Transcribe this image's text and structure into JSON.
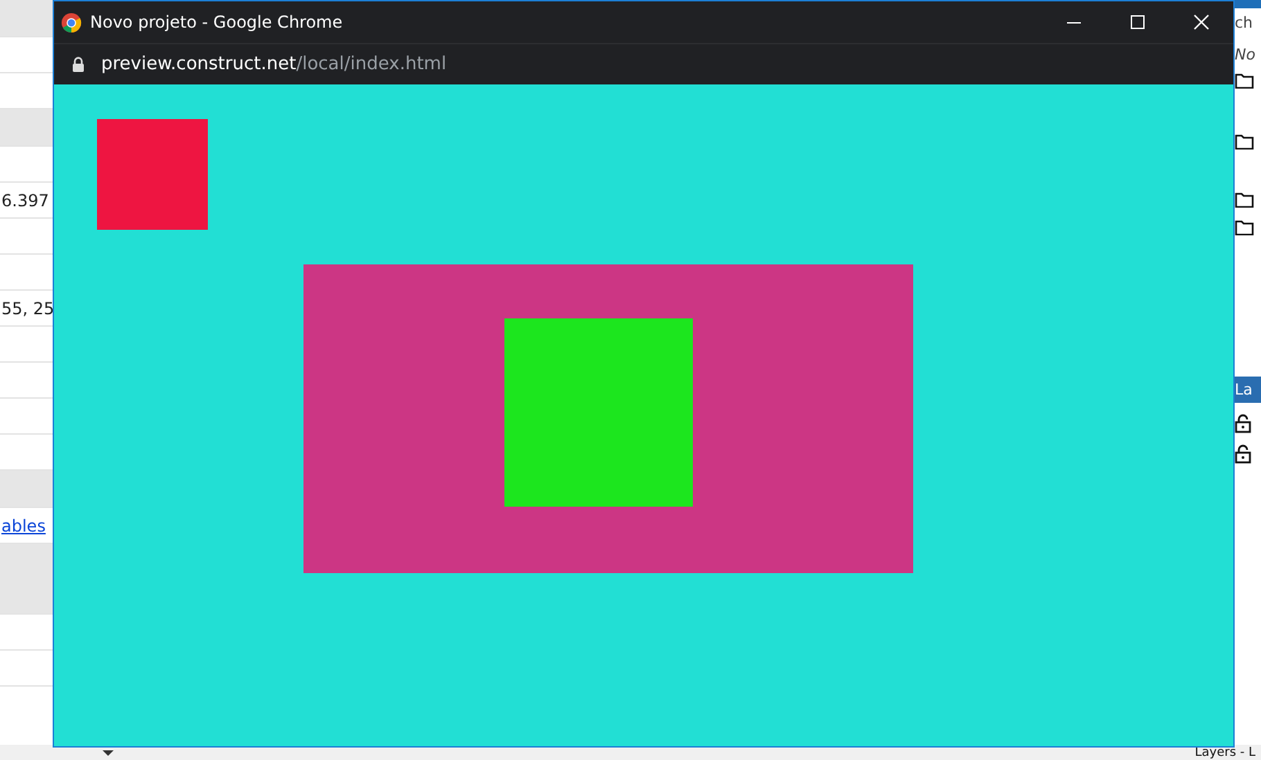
{
  "window": {
    "title": "Novo projeto - Google Chrome",
    "url_host": "preview.construct.net",
    "url_path": "/local/index.html"
  },
  "canvas": {
    "shapes": [
      {
        "color": "#ee1541"
      },
      {
        "color": "#cc3684"
      },
      {
        "color": "#1ce61e"
      }
    ]
  },
  "left_panel": {
    "values": [
      "6.397",
      "55, 25"
    ],
    "link": "ables"
  },
  "right_panel": {
    "search": "ch",
    "none_label": "No",
    "header": "La",
    "status": "Layers - L"
  }
}
